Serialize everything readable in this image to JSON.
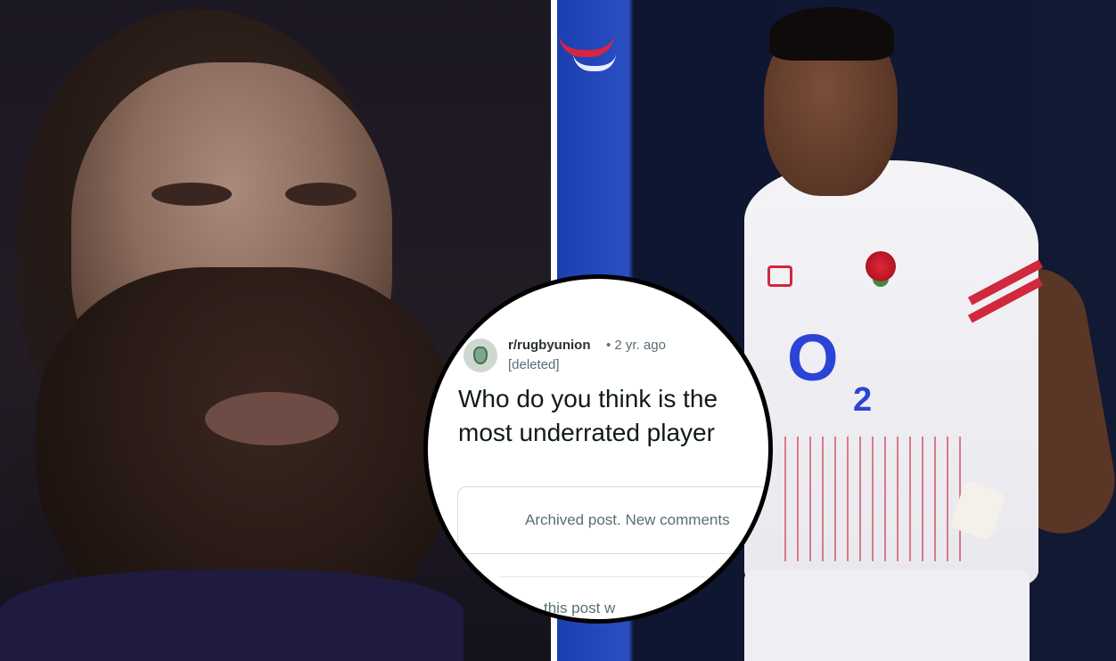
{
  "left_photo": {
    "description_icon": "bearded-player-photo"
  },
  "right_photo": {
    "sponsor_text": "O",
    "sponsor_sub": "2",
    "kit_brand_icon": "umbro-diamond-icon",
    "badge_icon": "red-rose-icon"
  },
  "reddit_post": {
    "subreddit": "r/rugbyunion",
    "age": "• 2 yr. ago",
    "author": "[deleted]",
    "title_line1": "Who do you think is the",
    "title_line2": "most underrated player",
    "archived_notice": "Archived post. New comments",
    "footer_fragment": "this post w",
    "avatar_icon": "subreddit-avatar-icon"
  },
  "colors": {
    "divider": "#ffffff",
    "inset_border": "#000000",
    "sponsor_blue": "#2b44d6",
    "stripe_red": "#d0283c",
    "stadium_blue": "#1c3fb0"
  }
}
